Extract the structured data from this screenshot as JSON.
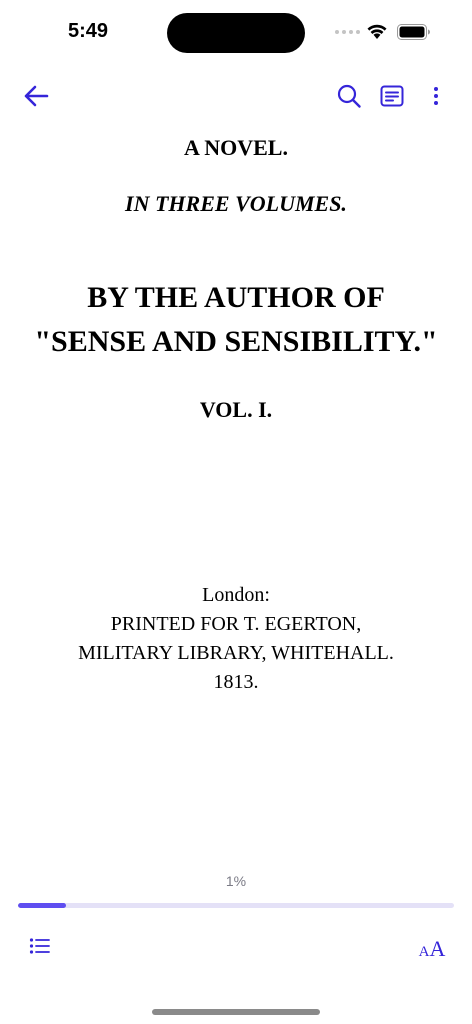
{
  "status_bar": {
    "time": "5:49"
  },
  "toolbar": {
    "back_icon": "arrow-left-icon",
    "search_icon": "search-icon",
    "notes_icon": "notes-icon",
    "more_icon": "more-vertical-icon"
  },
  "colors": {
    "accent": "#3525d9",
    "progress_fill": "#5f4ef0",
    "progress_track": "#e4e1f7"
  },
  "page": {
    "title": "A NOVEL.",
    "volumes": "IN THREE VOLUMES.",
    "author_line1": "BY THE AUTHOR OF",
    "author_line2": "\"SENSE AND SENSIBILITY.\"",
    "volume": "VOL. I.",
    "place": "London:",
    "printer": "PRINTED FOR T. EGERTON,",
    "library": "MILITARY LIBRARY, WHITEHALL.",
    "year": "1813."
  },
  "progress": {
    "label": "1%",
    "fraction": 0.11
  },
  "bottom_bar": {
    "toc_icon": "list-icon",
    "font_small": "A",
    "font_big": "A"
  }
}
